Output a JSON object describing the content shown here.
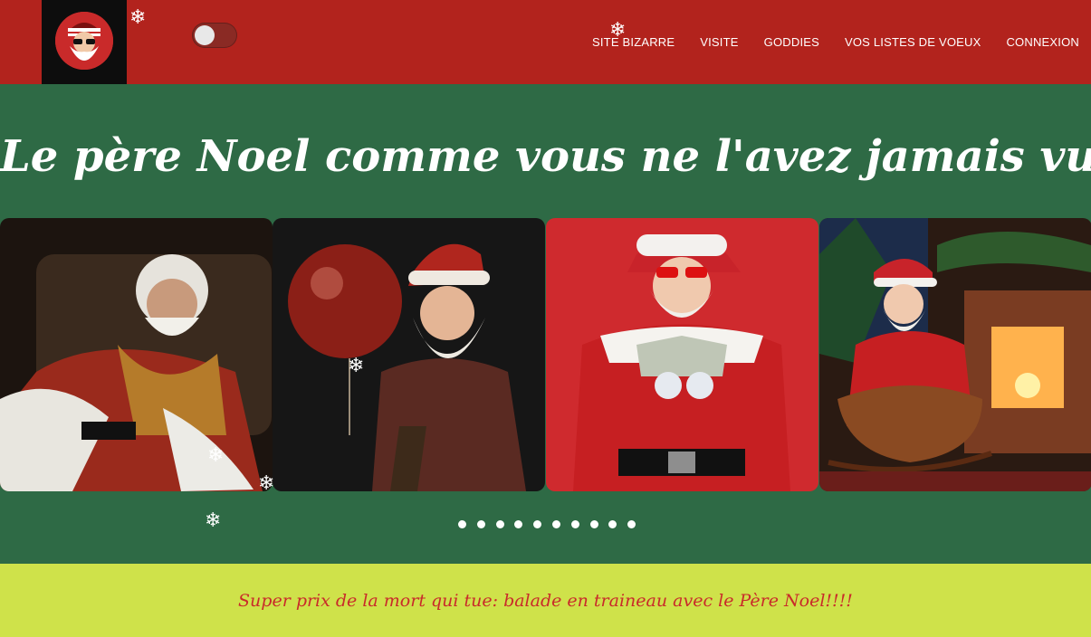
{
  "header": {
    "logo": "santa-logo",
    "nav": [
      "SITE BIZARRE",
      "VISITE",
      "GODDIES",
      "VOS LISTES DE VOEUX",
      "CONNEXION"
    ]
  },
  "hero": {
    "title": "Le père Noel comme vous ne l'avez jamais vu!"
  },
  "carousel": {
    "slides": [
      {
        "alt": "santa-on-armchair"
      },
      {
        "alt": "santa-with-red-balloon"
      },
      {
        "alt": "santa-with-money-and-sunglasses"
      },
      {
        "alt": "santa-in-sleigh-by-fireplace"
      }
    ],
    "dot_count": 10
  },
  "promo": {
    "text": "Super prix de la mort qui tue: balade en traineau avec le Père Noel!!!!"
  },
  "colors": {
    "header_red": "#b2231d",
    "hero_green": "#2e6a45",
    "promo_yellow": "#cfe24a",
    "promo_text": "#c92a2a"
  }
}
